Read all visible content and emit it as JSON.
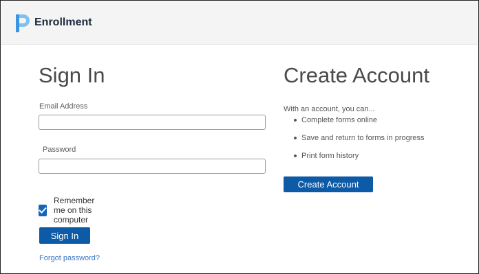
{
  "header": {
    "brand": "Enrollment"
  },
  "signin": {
    "title": "Sign In",
    "email_label": "Email Address",
    "email_value": "",
    "password_label": "Password",
    "password_value": "",
    "remember_label": "Remember me on this computer",
    "remember_checked": true,
    "submit_label": "Sign In",
    "forgot_label": "Forgot password?"
  },
  "create": {
    "title": "Create Account",
    "intro": "With an account, you can...",
    "bullets": [
      "Complete forms online",
      "Save and return to forms in progress",
      "Print form history"
    ],
    "button_label": "Create Account"
  },
  "colors": {
    "accent": "#0d5aa6",
    "link": "#3a76c4",
    "header_bg": "#f4f4f4"
  }
}
